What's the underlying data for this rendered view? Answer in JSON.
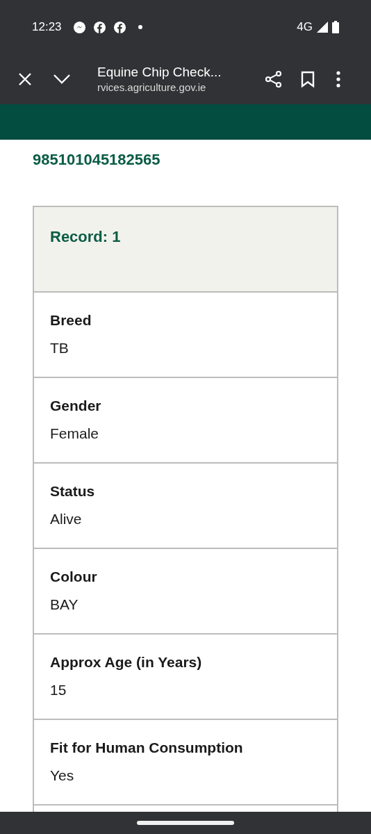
{
  "status_bar": {
    "time": "12:23",
    "network": "4G"
  },
  "browser_toolbar": {
    "title": "Equine Chip Check...",
    "url": "rvices.agriculture.gov.ie"
  },
  "chip_number": "985101045182565",
  "record": {
    "heading": "Record: 1",
    "fields": [
      {
        "label": "Breed",
        "value": "TB"
      },
      {
        "label": "Gender",
        "value": "Female"
      },
      {
        "label": "Status",
        "value": "Alive"
      },
      {
        "label": "Colour",
        "value": "BAY"
      },
      {
        "label": "Approx Age (in Years)",
        "value": "15"
      },
      {
        "label": "Fit for Human Consumption",
        "value": "Yes"
      }
    ]
  }
}
